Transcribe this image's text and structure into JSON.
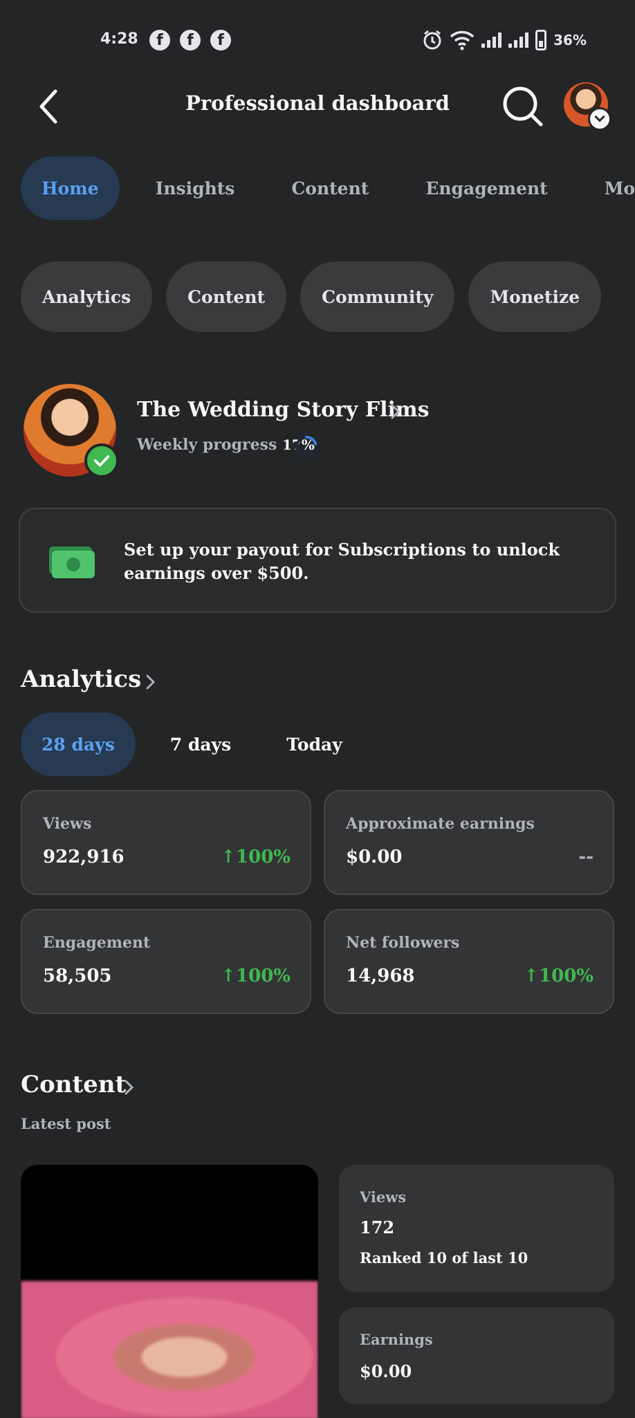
{
  "status_bar": {
    "time": "4:28",
    "battery": "36%",
    "app_icons": [
      "facebook-icon",
      "facebook-icon",
      "facebook-icon"
    ]
  },
  "header": {
    "title": "Professional dashboard"
  },
  "tabs": [
    {
      "label": "Home",
      "active": true
    },
    {
      "label": "Insights",
      "active": false
    },
    {
      "label": "Content",
      "active": false
    },
    {
      "label": "Engagement",
      "active": false
    },
    {
      "label": "Monetizati",
      "active": false
    }
  ],
  "chips": [
    "Analytics",
    "Content",
    "Community",
    "Monetize"
  ],
  "profile": {
    "name": "The Wedding Story Flims",
    "progress_label": "Weekly progress",
    "progress_value": "17%"
  },
  "payout": {
    "text": "Set up your payout for Subscriptions to unlock earnings over $500."
  },
  "analytics": {
    "title": "Analytics",
    "ranges": [
      {
        "label": "28 days",
        "active": true
      },
      {
        "label": "7 days",
        "active": false
      },
      {
        "label": "Today",
        "active": false
      }
    ],
    "metrics": [
      {
        "label": "Views",
        "value": "922,916",
        "change": "100%"
      },
      {
        "label": "Approximate earnings",
        "value": "$0.00",
        "change": "--"
      },
      {
        "label": "Engagement",
        "value": "58,505",
        "change": "100%"
      },
      {
        "label": "Net followers",
        "value": "14,968",
        "change": "100%"
      }
    ]
  },
  "content": {
    "title": "Content",
    "subtitle": "Latest post",
    "views_label": "Views",
    "views_value": "172",
    "views_rank": "Ranked 10 of last 10",
    "earnings_label": "Earnings",
    "earnings_value": "$0.00"
  },
  "colors": {
    "background": "#242526",
    "accent": "#5aa1f2",
    "positive": "#3fb950"
  }
}
